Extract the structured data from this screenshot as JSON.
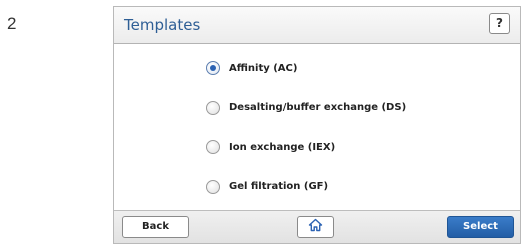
{
  "step_number": "2",
  "header": {
    "title": "Templates",
    "help_label": "?"
  },
  "options": [
    {
      "label": "Affinity (AC)",
      "selected": true
    },
    {
      "label": "Desalting/buffer exchange (DS)",
      "selected": false
    },
    {
      "label": "Ion exchange (IEX)",
      "selected": false
    },
    {
      "label": "Gel filtration (GF)",
      "selected": false
    }
  ],
  "footer": {
    "back_label": "Back",
    "home_icon": "home-icon",
    "select_label": "Select"
  },
  "colors": {
    "title": "#2e5e95",
    "accent": "#2b62b3",
    "select_button": "#2a6bb8"
  }
}
